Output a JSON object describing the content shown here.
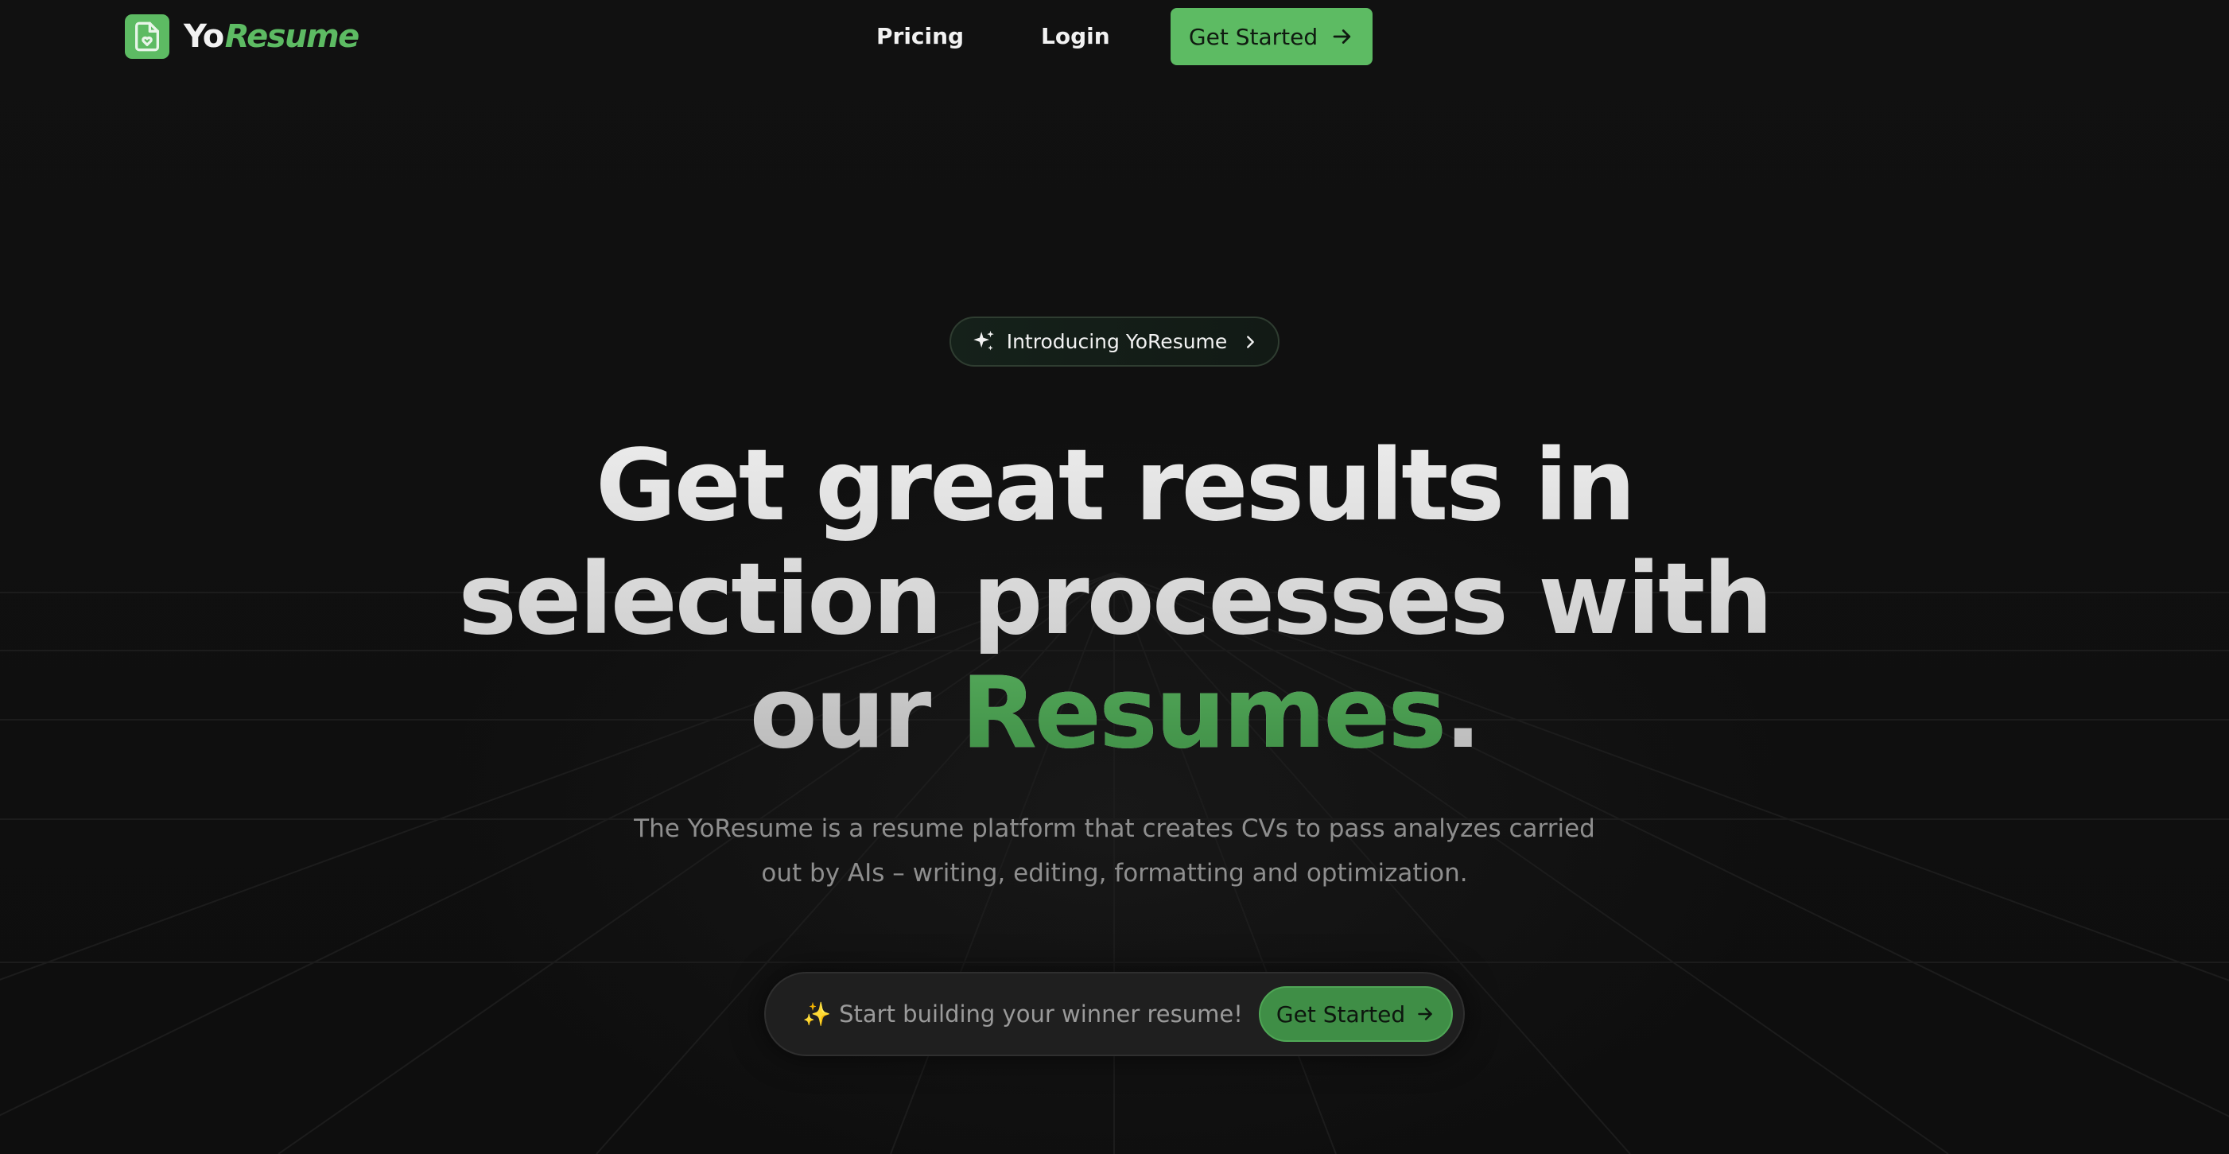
{
  "header": {
    "logo": {
      "part1": "Yo",
      "part2": "Resume"
    },
    "nav": {
      "pricing": "Pricing",
      "login": "Login"
    },
    "cta_label": "Get Started"
  },
  "hero": {
    "announcement": "Introducing YoResume",
    "headline": {
      "line1": "Get great results in",
      "line2": "selection processes with",
      "line3_prefix": "our",
      "line3_accent": "Resumes",
      "line3_suffix": "."
    },
    "subheadline": {
      "line1": "The YoResume is a resume platform that creates CVs to pass analyzes carried",
      "line2": "out by AIs – writing, editing, formatting and optimization."
    },
    "cta_bar": {
      "emoji": "✨",
      "text": "Start building your winner resume!",
      "button_label": "Get Started"
    }
  },
  "colors": {
    "background": "#101010",
    "accent": "#5dbb63",
    "accent_dark": "#3f8e46",
    "text": "#f2f2f2",
    "muted_text": "#8e8e8e"
  },
  "icons": {
    "logo": "document-heart-icon",
    "header_arrow": "arrow-right-icon",
    "announcement_left": "sparkles-icon",
    "announcement_right": "chevron-right-icon",
    "cta_arrow": "arrow-right-icon"
  }
}
